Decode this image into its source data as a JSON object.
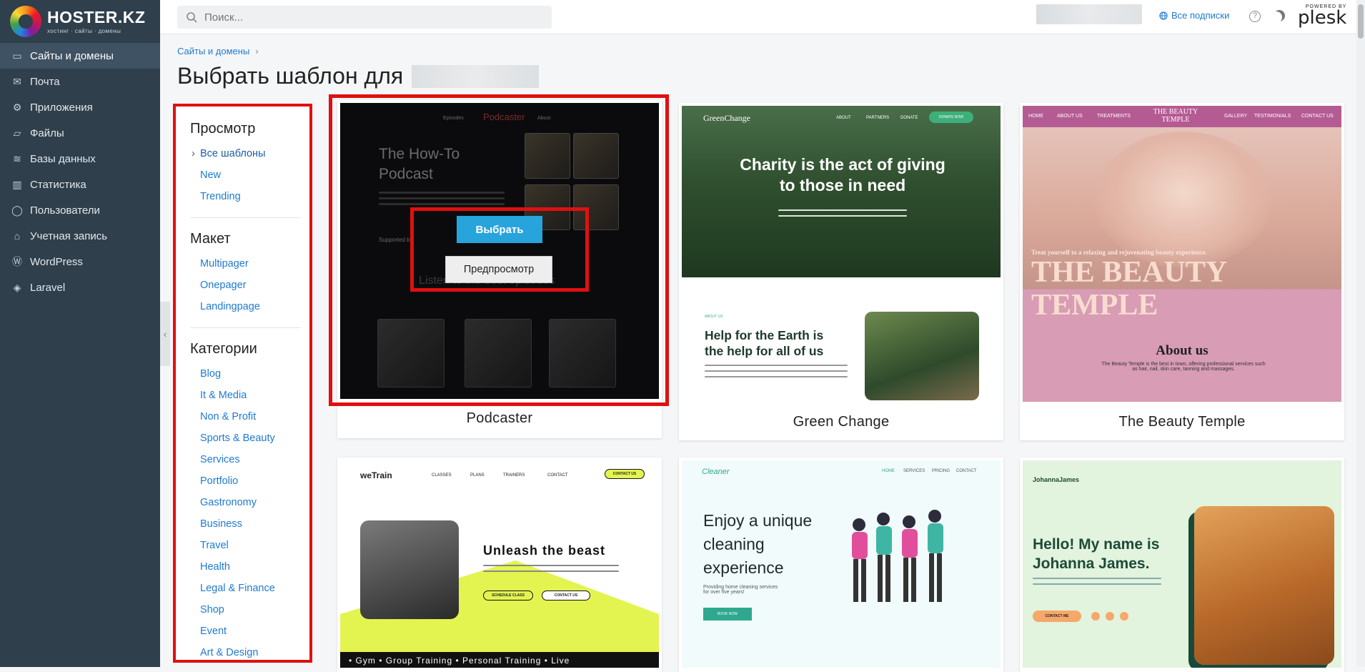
{
  "brand": {
    "name": "HOSTER.KZ",
    "tagline": "хостинг · сайты · домены"
  },
  "nav": {
    "items": [
      {
        "label": "Сайты и домены",
        "icon": "monitor-icon",
        "glyph": "▭",
        "active": true
      },
      {
        "label": "Почта",
        "icon": "mail-icon",
        "glyph": "✉"
      },
      {
        "label": "Приложения",
        "icon": "gear-icon",
        "glyph": "⚙"
      },
      {
        "label": "Файлы",
        "icon": "folder-icon",
        "glyph": "▱"
      },
      {
        "label": "Базы данных",
        "icon": "layers-icon",
        "glyph": "≋"
      },
      {
        "label": "Статистика",
        "icon": "chart-icon",
        "glyph": "▥"
      },
      {
        "label": "Пользователи",
        "icon": "user-icon",
        "glyph": "◯"
      },
      {
        "label": "Учетная запись",
        "icon": "account-icon",
        "glyph": "⌂"
      },
      {
        "label": "WordPress",
        "icon": "wordpress-icon",
        "glyph": "Ⓦ"
      },
      {
        "label": "Laravel",
        "icon": "laravel-icon",
        "glyph": "◈"
      }
    ],
    "collapse_glyph": "‹"
  },
  "topbar": {
    "search_placeholder": "Поиск...",
    "subscriptions_label": "Все подписки",
    "help_glyph": "?",
    "plesk_powered": "POWERED BY",
    "plesk_name": "plesk"
  },
  "breadcrumb": {
    "item": "Сайты и домены",
    "sep": "›"
  },
  "page_title": "Выбрать шаблон для",
  "filters": {
    "sections": [
      {
        "title": "Просмотр",
        "items": [
          "Все шаблоны",
          "New",
          "Trending"
        ],
        "active_index": 0
      },
      {
        "title": "Макет",
        "items": [
          "Multipager",
          "Onepager",
          "Landingpage"
        ]
      },
      {
        "title": "Категории",
        "items": [
          "Blog",
          "It & Media",
          "Non & Profit",
          "Sports & Beauty",
          "Services",
          "Portfolio",
          "Gastronomy",
          "Business",
          "Travel",
          "Health",
          "Legal & Finance",
          "Shop",
          "Event",
          "Art & Design"
        ]
      }
    ]
  },
  "templates": {
    "podcaster": {
      "name": "Podcaster",
      "nav": [
        "Episodes",
        "Podcaster",
        "About"
      ],
      "hero": "The How-To Podcast",
      "supported": "Supported by:",
      "section": "Listen to the best episodes",
      "select_label": "Выбрать",
      "preview_label": "Предпросмотр"
    },
    "green_change": {
      "name": "Green Change",
      "logo": "GreenChange",
      "nav": [
        "ABOUT",
        "PARTNERS",
        "DONATE"
      ],
      "cta": "DONATE NOW",
      "headline": "Charity is the act of giving to those in need",
      "about_tag": "ABOUT US",
      "subheadline": "Help for the Earth is the help for all of us"
    },
    "beauty_temple": {
      "name": "The Beauty Temple",
      "nav": [
        "HOME",
        "ABOUT US",
        "TREATMENTS",
        "THE BEAUTY TEMPLE",
        "GALLERY",
        "TESTIMONIALS",
        "CONTACT US"
      ],
      "tagline": "Treat yourself to a relaxing and rejuvenating beauty experience.",
      "headline": "THE BEAUTY TEMPLE",
      "about": "About us",
      "about_text": "The Beauty Temple is the best in town, offering professional services such as hair, nail, skin care, tanning and massages."
    },
    "wetrain": {
      "logo": "weTrain",
      "nav": [
        "CLASSES",
        "PLANS",
        "TRAINERS",
        "CONTACT"
      ],
      "cta": "CONTACT US",
      "headline": "Unleash the beast",
      "btn1": "SCHEDULE CLASS",
      "btn2": "CONTACT US",
      "strip": "• Gym • Group Training • Personal Training • Live"
    },
    "cleaner": {
      "logo": "Cleaner",
      "nav": [
        "HOME",
        "SERVICES",
        "PRICING",
        "CONTACT"
      ],
      "headline": "Enjoy a unique cleaning experience",
      "sub": "Providing home cleaning services for over five years!",
      "btn": "BOOK NOW"
    },
    "johanna": {
      "logo": "JohannaJames",
      "headline": "Hello! My name is Johanna James.",
      "btn": "CONTACT ME"
    }
  }
}
